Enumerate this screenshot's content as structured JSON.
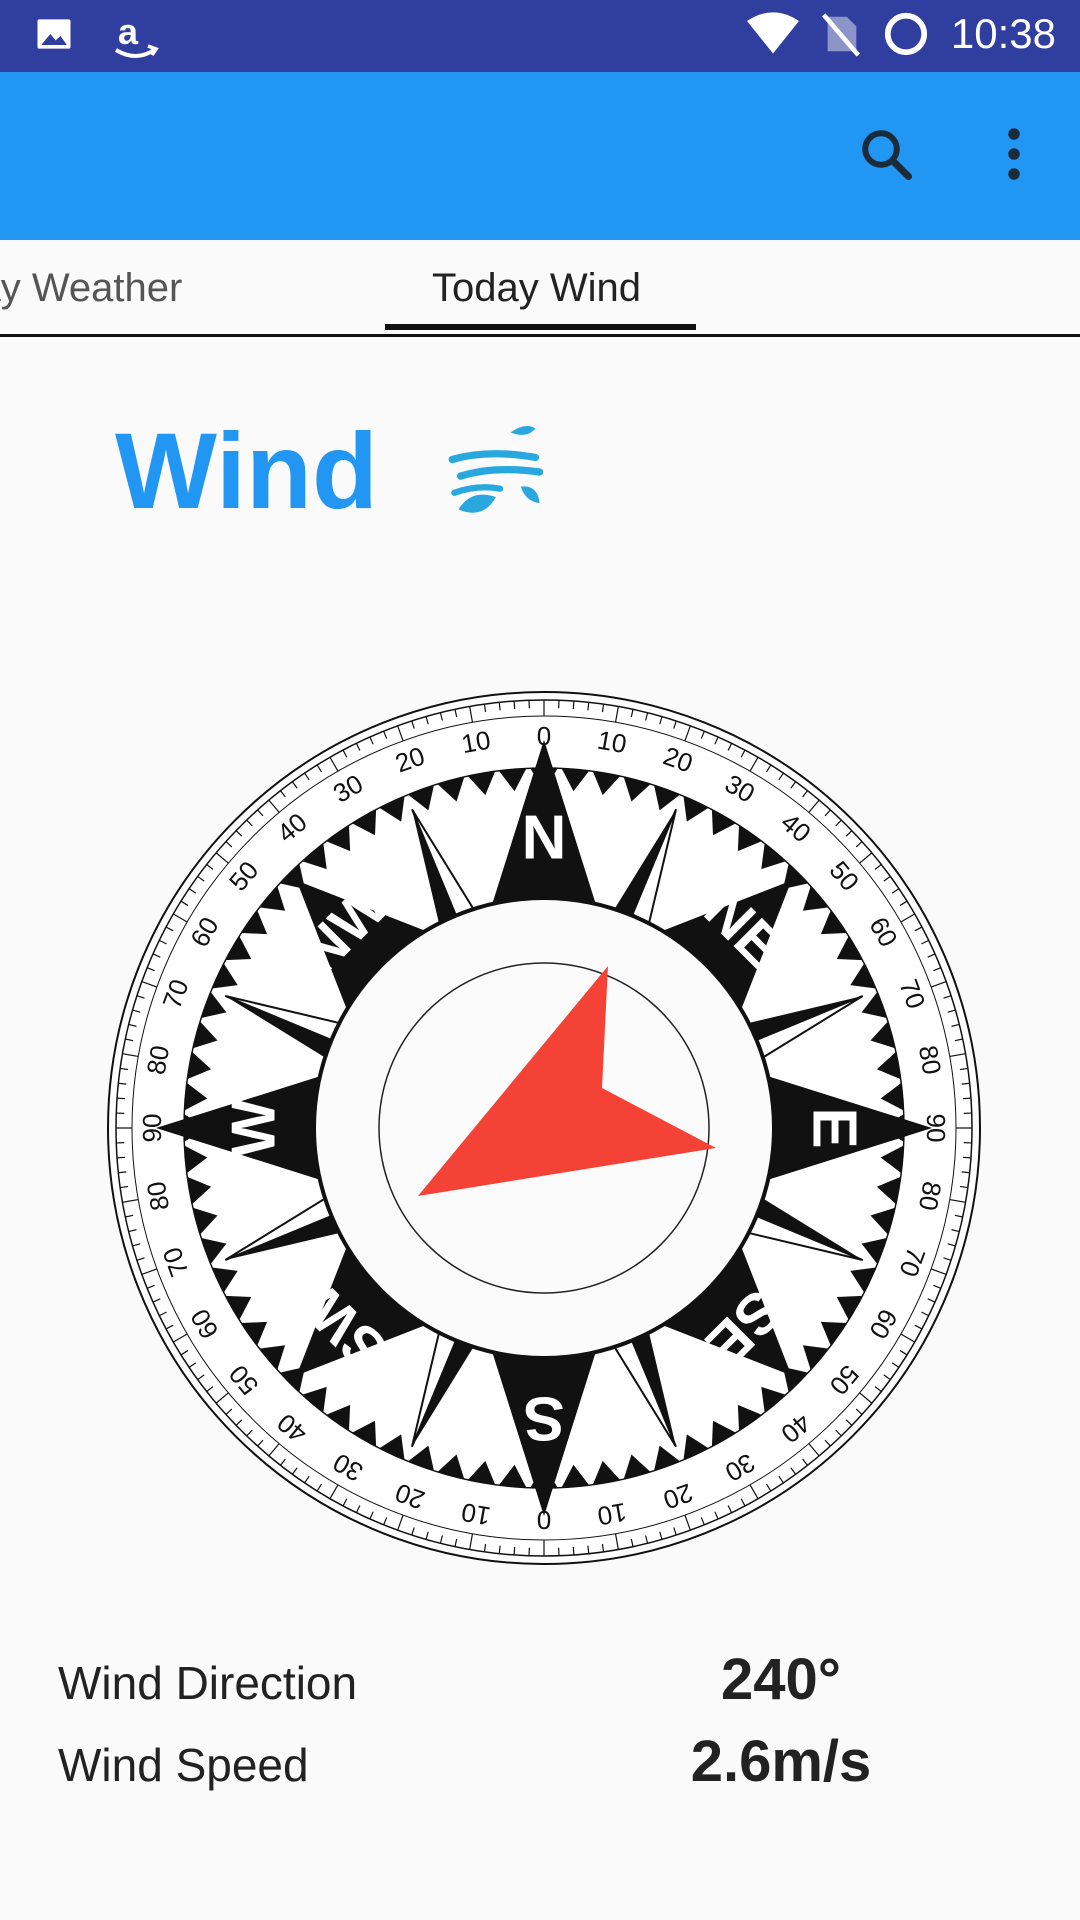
{
  "status_bar": {
    "time": "10:38",
    "background": "#303f9f",
    "icons": [
      "image-icon",
      "amazon-icon",
      "wifi-icon",
      "no-sim-icon",
      "circle-status-icon"
    ]
  },
  "app_bar": {
    "background": "#2196f3",
    "actions": [
      "search-icon",
      "more-vert-icon"
    ]
  },
  "tabs": [
    {
      "label": "Today Weather",
      "selected": false
    },
    {
      "label": "Today Wind",
      "selected": true
    }
  ],
  "wind_card": {
    "title": "Wind",
    "title_color": "#2196f3",
    "icon": "wind-leaves-icon",
    "icon_color": "#29a8e0"
  },
  "compass": {
    "cardinals": [
      "N",
      "NE",
      "E",
      "SE",
      "S",
      "SW",
      "W",
      "NW"
    ],
    "degree_labels": [
      "0",
      "10",
      "20",
      "30",
      "40",
      "50",
      "60",
      "70",
      "80",
      "90"
    ],
    "arrow_color": "#f44336",
    "direction_deg": 240
  },
  "stats": {
    "direction_label": "Wind Direction",
    "direction_value": "240°",
    "speed_label": "Wind Speed",
    "speed_value": "2.6m/s"
  }
}
